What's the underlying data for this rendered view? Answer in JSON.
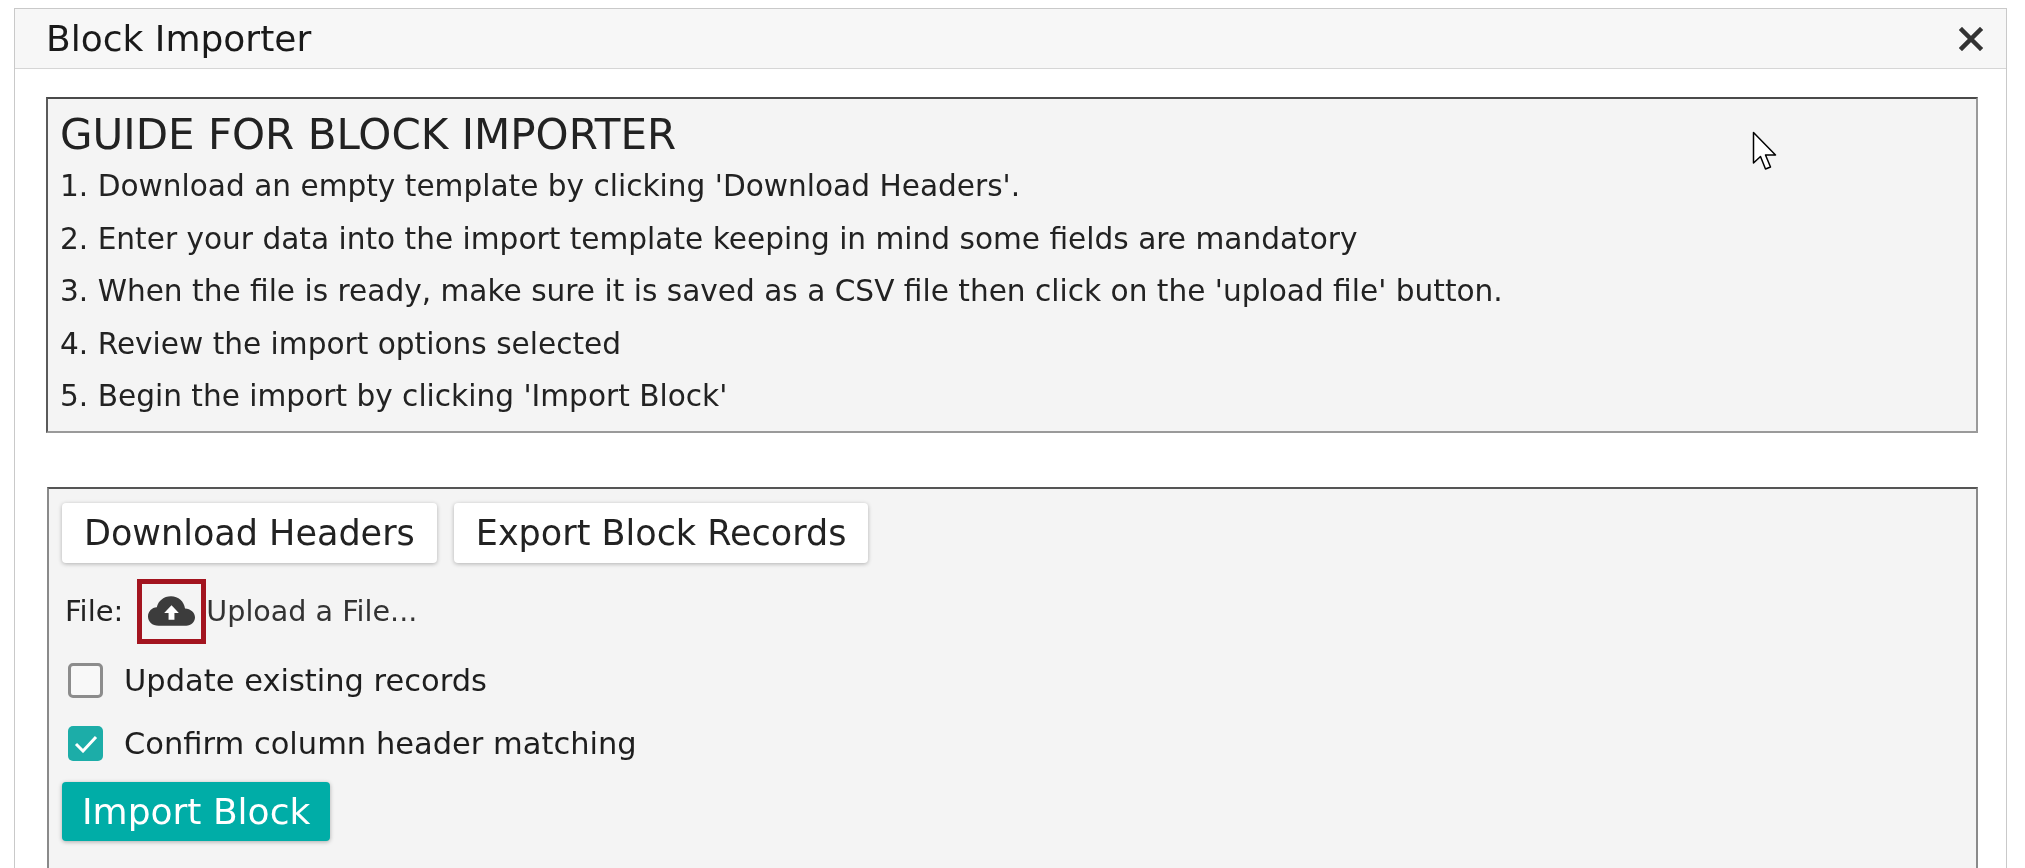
{
  "dialog": {
    "title": "Block Importer"
  },
  "guide": {
    "heading": "GUIDE FOR BLOCK IMPORTER",
    "steps": [
      "1. Download an empty template by clicking 'Download Headers'.",
      "2. Enter your data into the import template keeping in mind some fields are mandatory",
      "3. When the file is ready, make sure it is saved as a CSV file then click on the 'upload file' button.",
      "4. Review the import options selected",
      "5. Begin the import by clicking 'Import Block'"
    ]
  },
  "importer": {
    "buttons": [
      "Download Headers",
      "Export Block Records"
    ],
    "file": {
      "label": "File:",
      "upload_text": "Upload a File...",
      "highlighted": true
    },
    "options": [
      {
        "label": "Update existing records",
        "checked": false
      },
      {
        "label": "Confirm column header matching",
        "checked": true
      }
    ],
    "submit": "Import Block"
  }
}
